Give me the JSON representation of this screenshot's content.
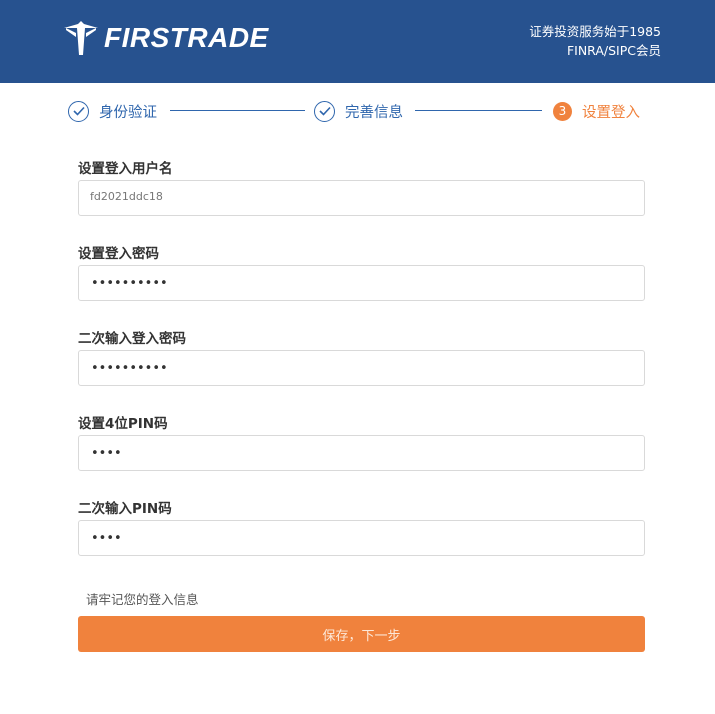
{
  "header": {
    "brand": "FIRSTRADE",
    "tagline_line1": "证券投资服务始于1985",
    "tagline_line2": "FINRA/SIPC会员"
  },
  "steps": [
    {
      "label": "身份验证",
      "state": "done"
    },
    {
      "label": "完善信息",
      "state": "done"
    },
    {
      "label": "设置登入",
      "state": "active",
      "number": "3"
    }
  ],
  "form": {
    "username": {
      "label": "设置登入用户名",
      "value": "fd2021ddc18"
    },
    "password": {
      "label": "设置登入密码",
      "value": "••••••••••"
    },
    "password_confirm": {
      "label": "二次输入登入密码",
      "value": "••••••••••"
    },
    "pin": {
      "label": "设置4位PIN码",
      "value": "••••"
    },
    "pin_confirm": {
      "label": "二次输入PIN码",
      "value": "••••"
    },
    "reminder": "请牢记您的登入信息",
    "submit_label": "保存，下一步"
  },
  "colors": {
    "header_bg": "#27528f",
    "step_blue": "#2f66ad",
    "accent_orange": "#f0823d"
  }
}
